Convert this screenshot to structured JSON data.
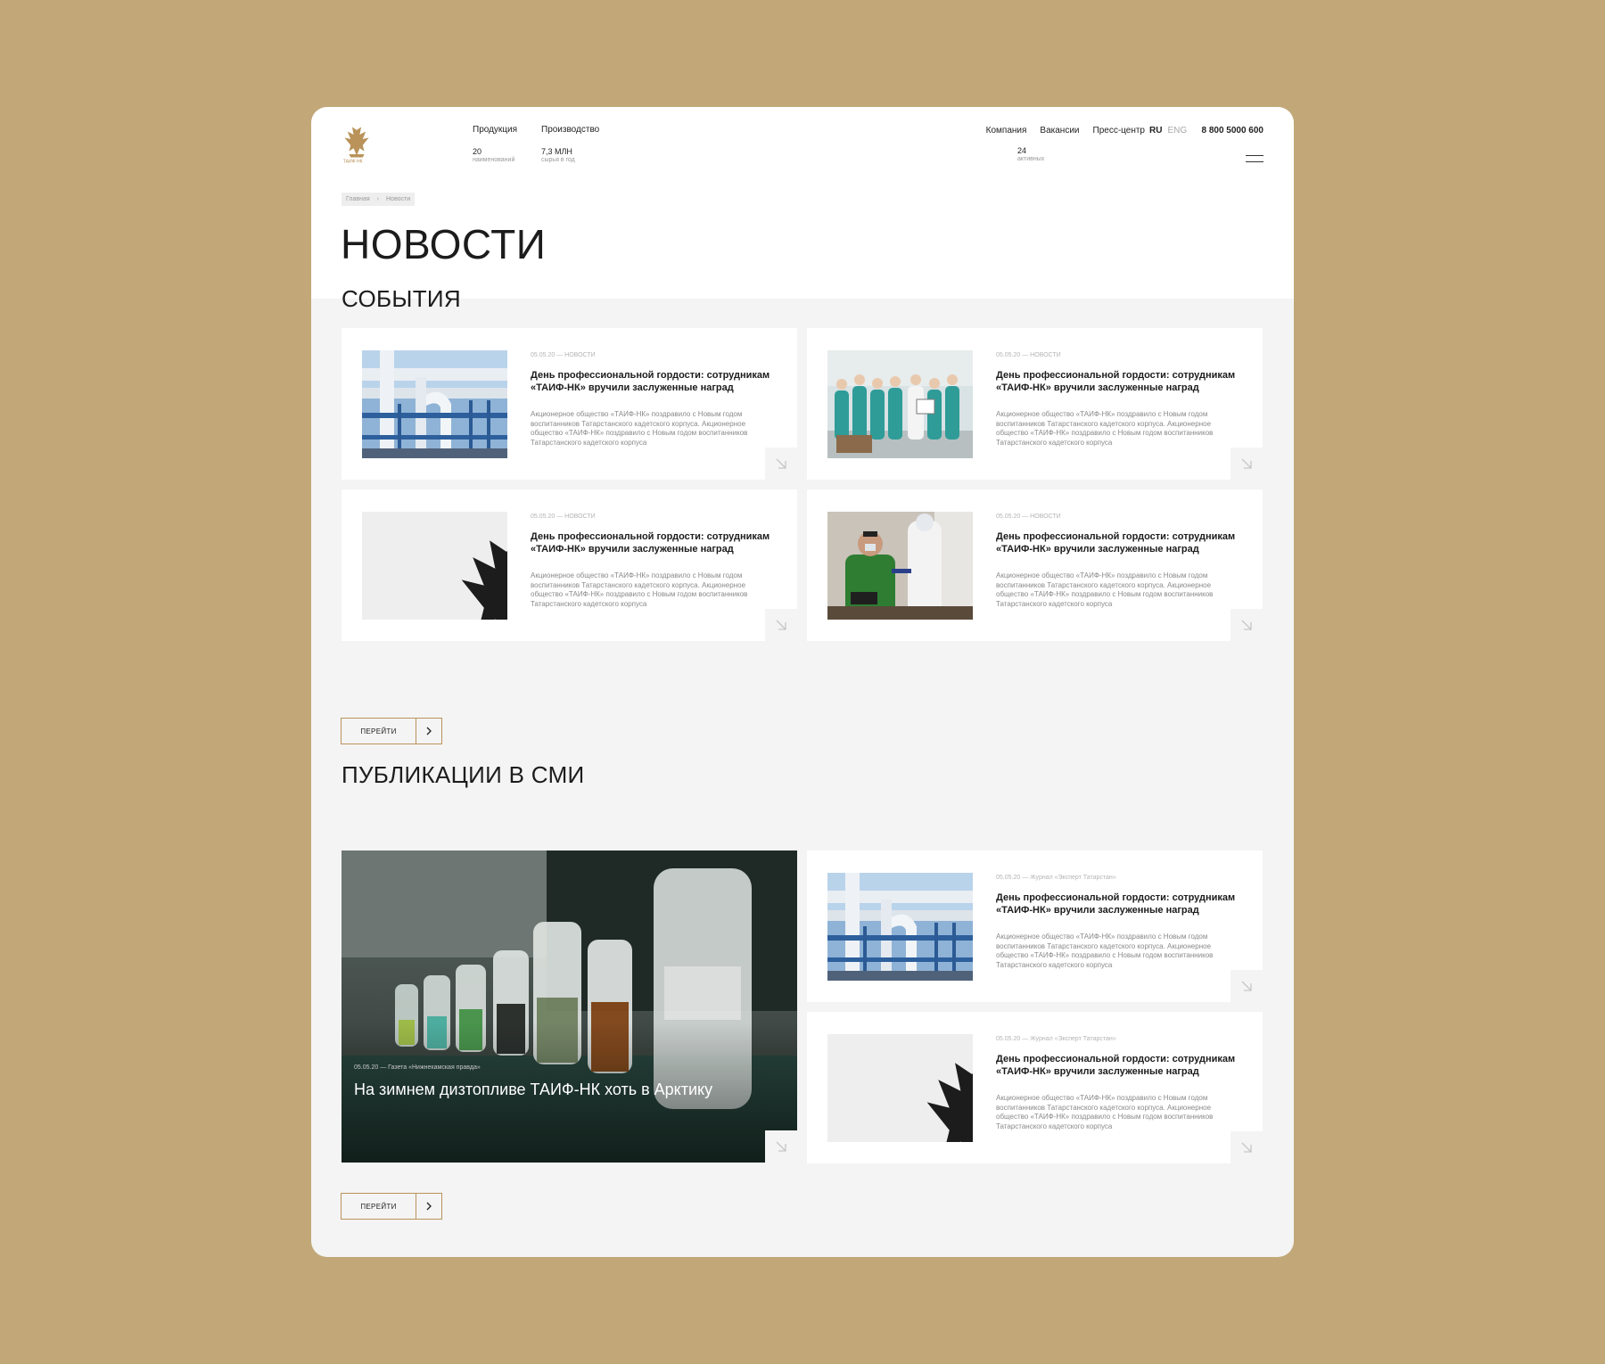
{
  "header": {
    "nav": [
      {
        "label": "Продукция",
        "number": "20",
        "sub": "наименований"
      },
      {
        "label": "Производство",
        "number": "7,3 МЛН",
        "sub": "сырья в год"
      }
    ],
    "menu": [
      "Компания",
      "Вакансии",
      "Пресс-центр"
    ],
    "vacancies": {
      "number": "24",
      "sub": "активных"
    },
    "lang_active": "RU",
    "lang_inactive": "ENG",
    "phone": "8 800 5000 600"
  },
  "breadcrumb": [
    "Главная",
    "Новости"
  ],
  "page_title": "НОВОСТИ",
  "events": {
    "title": "СОБЫТИЯ",
    "cards": [
      {
        "meta": "05.05.20 — НОВОСТИ",
        "title": "День профессиональной гордости: сотрудникам «ТАИФ-НК» вручили заслуженные наград",
        "text": "Акционерное общество «ТАИФ-НК» поздравило с Новым годом воспитанников Татарстанского кадетского корпуса. Акционерное общество «ТАИФ-НК» поздравило с Новым годом воспитанников Татарстанского кадетского корпуса",
        "image": "pipes"
      },
      {
        "meta": "05.05.20 — НОВОСТИ",
        "title": "День профессиональной гордости: сотрудникам «ТАИФ-НК» вручили заслуженные наград",
        "text": "Акционерное общество «ТАИФ-НК» поздравило с Новым годом воспитанников Татарстанского кадетского корпуса. Акционерное общество «ТАИФ-НК» поздравило с Новым годом воспитанников Татарстанского кадетского корпуса",
        "image": "group"
      },
      {
        "meta": "05.05.20 — НОВОСТИ",
        "title": "День профессиональной гордости: сотрудникам «ТАИФ-НК» вручили заслуженные наград",
        "text": "Акционерное общество «ТАИФ-НК» поздравило с Новым годом воспитанников Татарстанского кадетского корпуса. Акционерное общество «ТАИФ-НК» поздравило с Новым годом воспитанников Татарстанского кадетского корпуса",
        "image": "placeholder"
      },
      {
        "meta": "05.05.20 — НОВОСТИ",
        "title": "День профессиональной гордости: сотрудникам «ТАИФ-НК» вручили заслуженные наград",
        "text": "Акционерное общество «ТАИФ-НК» поздравило с Новым годом воспитанников Татарстанского кадетского корпуса. Акционерное общество «ТАИФ-НК» поздравило с Новым годом воспитанников Татарстанского кадетского корпуса",
        "image": "vaccine"
      }
    ],
    "button": "ПЕРЕЙТИ"
  },
  "publications": {
    "title": "ПУБЛИКАЦИИ В СМИ",
    "feature": {
      "meta": "05.05.20 — Газета «Нижнекамская правда»",
      "title": "На зимнем дизтопливе ТАИФ-НК хоть в Арктику"
    },
    "cards": [
      {
        "meta": "05.05.20 — Журнал «Эксперт Татарстан»",
        "title": "День профессиональной гордости: сотрудникам «ТАИФ-НК» вручили заслуженные наград",
        "text": "Акционерное общество «ТАИФ-НК» поздравило с Новым годом воспитанников Татарстанского кадетского корпуса. Акционерное общество «ТАИФ-НК» поздравило с Новым годом воспитанников Татарстанского кадетского корпуса",
        "image": "pipes"
      },
      {
        "meta": "05.05.20 — Журнал «Эксперт Татарстан»",
        "title": "День профессиональной гордости: сотрудникам «ТАИФ-НК» вручили заслуженные наград",
        "text": "Акционерное общество «ТАИФ-НК» поздравило с Новым годом воспитанников Татарстанского кадетского корпуса. Акционерное общество «ТАИФ-НК» поздравило с Новым годом воспитанников Татарстанского кадетского корпуса",
        "image": "placeholder"
      }
    ],
    "button": "ПЕРЕЙТИ"
  },
  "colors": {
    "page_bg": "#c2a878",
    "accent": "#b9935a",
    "panel": "#f4f4f4"
  },
  "icons": [
    "griffin-logo-icon",
    "arrow-down-right-icon",
    "chevron-right-icon",
    "menu-icon"
  ]
}
